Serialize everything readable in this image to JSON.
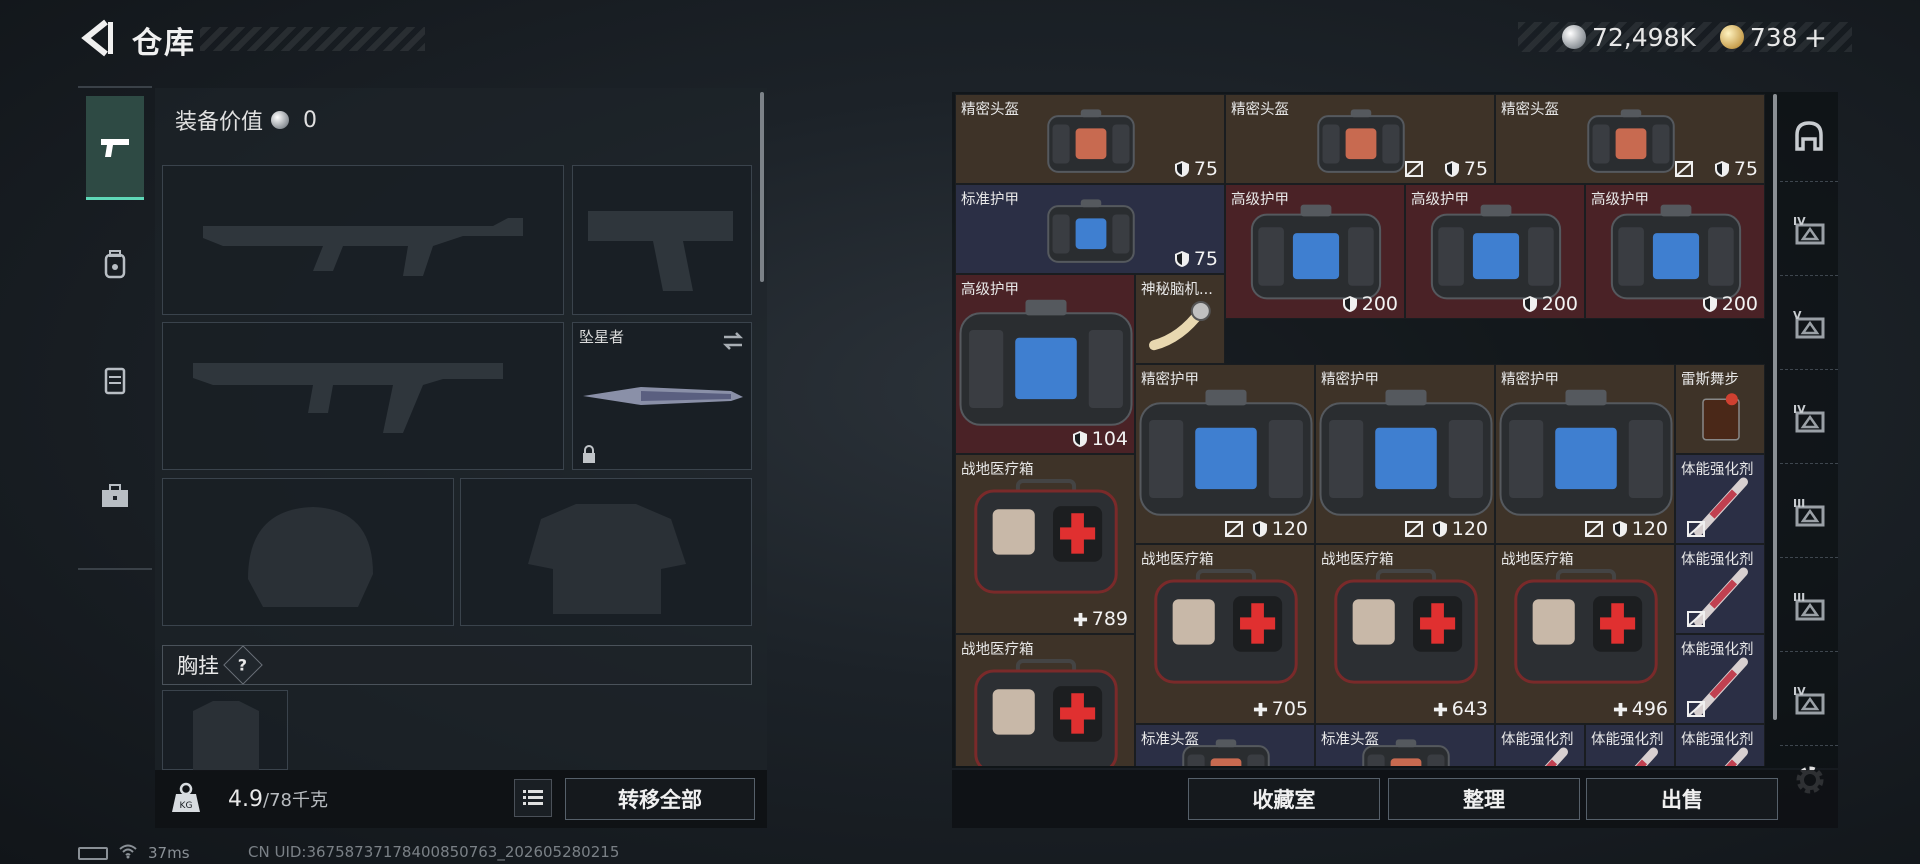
{
  "header": {
    "title": "仓库",
    "silver_amount": "72,498K",
    "gold_amount": "738",
    "gold_add_symbol": "+"
  },
  "loadout": {
    "equip_value_label": "装备价值",
    "equip_value": "0",
    "melee_label": "坠星者",
    "chest_rig_label": "胸挂",
    "chest_rig_help": "?",
    "weight_current": "4.9",
    "weight_max": "/78千克",
    "transfer_all_label": "转移全部"
  },
  "left_tabs": [
    {
      "name": "weapons",
      "icon": "pistol-icon",
      "active": true
    },
    {
      "name": "backpack",
      "icon": "backpack-icon",
      "active": false
    },
    {
      "name": "armor",
      "icon": "vest-icon",
      "active": false
    },
    {
      "name": "case",
      "icon": "briefcase-icon",
      "active": false
    }
  ],
  "inventory": [
    {
      "name": "精密头盔",
      "value": "75",
      "type": "shield",
      "color": "brown",
      "no_trade": false,
      "icon": "helmet-bag"
    },
    {
      "name": "精密头盔",
      "value": "75",
      "type": "shield",
      "color": "brown",
      "no_trade": true,
      "icon": "helmet-bag"
    },
    {
      "name": "精密头盔",
      "value": "75",
      "type": "shield",
      "color": "brown",
      "no_trade": true,
      "icon": "helmet-bag"
    },
    {
      "name": "标准护甲",
      "value": "75",
      "type": "shield",
      "color": "navy",
      "no_trade": false,
      "icon": "armor-bag"
    },
    {
      "name": "高级护甲",
      "value": "200",
      "type": "shield",
      "color": "red",
      "no_trade": false,
      "icon": "armor-bag"
    },
    {
      "name": "高级护甲",
      "value": "200",
      "type": "shield",
      "color": "red",
      "no_trade": false,
      "icon": "armor-bag"
    },
    {
      "name": "高级护甲",
      "value": "200",
      "type": "shield",
      "color": "red",
      "no_trade": false,
      "icon": "armor-bag"
    },
    {
      "name": "高级护甲",
      "value": "104",
      "type": "shield",
      "color": "red",
      "no_trade": false,
      "icon": "armor-bag"
    },
    {
      "name": "神秘脑机...",
      "value": "",
      "type": "",
      "color": "brown",
      "no_trade": false,
      "icon": "chip"
    },
    {
      "name": "精密护甲",
      "value": "120",
      "type": "shield",
      "color": "brown",
      "no_trade": true,
      "icon": "armor-bag"
    },
    {
      "name": "精密护甲",
      "value": "120",
      "type": "shield",
      "color": "brown",
      "no_trade": true,
      "icon": "armor-bag"
    },
    {
      "name": "精密护甲",
      "value": "120",
      "type": "shield",
      "color": "brown",
      "no_trade": true,
      "icon": "armor-bag"
    },
    {
      "name": "雷斯舞步",
      "value": "",
      "type": "",
      "color": "brown",
      "no_trade": false,
      "icon": "drink"
    },
    {
      "name": "战地医疗箱",
      "value": "789",
      "type": "plus",
      "color": "brown",
      "no_trade": false,
      "icon": "medkit"
    },
    {
      "name": "体能强化剂",
      "value": "",
      "type": "",
      "color": "navy",
      "no_trade": true,
      "icon": "syringe"
    },
    {
      "name": "战地医疗箱",
      "value": "705",
      "type": "plus",
      "color": "brown",
      "no_trade": false,
      "icon": "medkit"
    },
    {
      "name": "战地医疗箱",
      "value": "643",
      "type": "plus",
      "color": "brown",
      "no_trade": false,
      "icon": "medkit"
    },
    {
      "name": "战地医疗箱",
      "value": "496",
      "type": "plus",
      "color": "brown",
      "no_trade": false,
      "icon": "medkit"
    },
    {
      "name": "体能强化剂",
      "value": "",
      "type": "",
      "color": "navy",
      "no_trade": true,
      "icon": "syringe"
    },
    {
      "name": "战地医疗箱",
      "value": "",
      "type": "plus",
      "color": "brown",
      "no_trade": false,
      "icon": "medkit"
    },
    {
      "name": "体能强化剂",
      "value": "",
      "type": "",
      "color": "navy",
      "no_trade": true,
      "icon": "syringe"
    },
    {
      "name": "标准头盔",
      "value": "",
      "type": "",
      "color": "navy",
      "no_trade": false,
      "icon": "helmet-bag"
    },
    {
      "name": "标准头盔",
      "value": "",
      "type": "",
      "color": "navy",
      "no_trade": false,
      "icon": "helmet-bag"
    },
    {
      "name": "体能强化剂",
      "value": "",
      "type": "",
      "color": "navy",
      "no_trade": false,
      "icon": "syringe"
    },
    {
      "name": "体能强化剂",
      "value": "",
      "type": "",
      "color": "navy",
      "no_trade": false,
      "icon": "syringe"
    },
    {
      "name": "体能强化剂",
      "value": "",
      "type": "",
      "color": "navy",
      "no_trade": false,
      "icon": "syringe"
    }
  ],
  "right_tabs": [
    {
      "icon": "helmet-tab-icon",
      "level": ""
    },
    {
      "icon": "level-iv-folder-icon",
      "level": "IV"
    },
    {
      "icon": "level-v-crate-icon",
      "level": "V"
    },
    {
      "icon": "level-iv-medkit-icon",
      "level": "IV"
    },
    {
      "icon": "level-iii-triangle-icon",
      "level": "III"
    },
    {
      "icon": "level-iii-triangle-icon",
      "level": "III"
    },
    {
      "icon": "level-iv-crate-icon",
      "level": "IV"
    }
  ],
  "footer_buttons": {
    "collection": "收藏室",
    "sort": "整理",
    "sell": "出售"
  },
  "status": {
    "ping": "37ms",
    "uid": "CN UID:36758737178400850763_202605280215"
  }
}
